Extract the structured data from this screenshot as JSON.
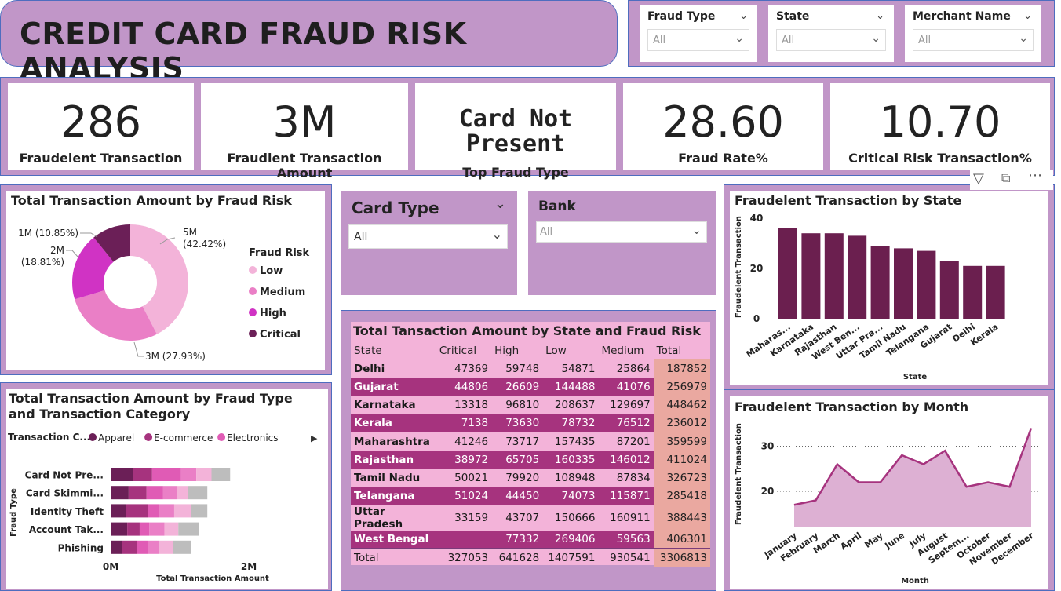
{
  "title": "CREDIT CARD FRAUD RISK ANALYSIS",
  "slicers": [
    {
      "label": "Fraud Type",
      "value": "All"
    },
    {
      "label": "State",
      "value": "All"
    },
    {
      "label": "Merchant Name",
      "value": "All"
    }
  ],
  "kpis": [
    {
      "value": "286",
      "label": "Fraudelent Transaction"
    },
    {
      "value": "3M",
      "label": "Fraudlent Transaction Amount"
    },
    {
      "value": "Card Not Present",
      "label": "Top Fraud Type"
    },
    {
      "value": "28.60",
      "label": "Fraud Rate%"
    },
    {
      "value": "10.70",
      "label": "Critical Risk Transaction%"
    }
  ],
  "card_type": {
    "label": "Card Type",
    "value": "All"
  },
  "bank": {
    "label": "Bank",
    "value": "All"
  },
  "colors": {
    "panel": "#c196c8",
    "low": "#f3b3d9",
    "medium": "#ea7fc6",
    "high": "#d033c4",
    "critical": "#6b1f57",
    "bar": "#6b1f4f",
    "line": "#a6337e",
    "area": "#ddb0d3"
  },
  "chart_data": [
    {
      "type": "pie",
      "title": "Total Transaction Amount by Fraud Risk",
      "legend_title": "Fraud Risk",
      "legend_position": "right",
      "slices": [
        {
          "name": "Low",
          "value": 42.42,
          "label": "5M\n(42.42%)"
        },
        {
          "name": "Medium",
          "value": 27.93,
          "label": "3M (27.93%)"
        },
        {
          "name": "High",
          "value": 18.81,
          "label": "2M\n(18.81%)"
        },
        {
          "name": "Critical",
          "value": 10.85,
          "label": "1M (10.85%)"
        }
      ]
    },
    {
      "type": "bar",
      "orientation": "horizontal",
      "stacked": true,
      "title": "Total Transaction Amount by Fraud Type and Transaction Category",
      "legend_title": "Transaction C...",
      "legend_visible": [
        "Apparel",
        "E-commerce",
        "Electronics"
      ],
      "categories": [
        "Card Not Pre...",
        "Card Skimmi...",
        "Identity Theft",
        "Account Tak...",
        "Phishing"
      ],
      "xlabel": "Total Transaction Amount",
      "ylabel": "Fraud Type",
      "xticks": [
        "0M",
        "2M"
      ],
      "xlim": [
        0,
        3
      ],
      "series": [
        {
          "name": "Apparel",
          "color": "#6b1f57",
          "values": [
            0.32,
            0.26,
            0.22,
            0.24,
            0.16
          ]
        },
        {
          "name": "E-commerce",
          "color": "#a6337e",
          "values": [
            0.28,
            0.26,
            0.32,
            0.18,
            0.22
          ]
        },
        {
          "name": "Electronics",
          "color": "#e05bb5",
          "values": [
            0.42,
            0.24,
            0.16,
            0.14,
            0.16
          ]
        },
        {
          "name": "",
          "color": "#ea7fc6",
          "values": [
            0.22,
            0.2,
            0.22,
            0.22,
            0.16
          ]
        },
        {
          "name": "",
          "color": "#f3b3d9",
          "values": [
            0.22,
            0.16,
            0.24,
            0.2,
            0.2
          ]
        },
        {
          "name": "",
          "color": "#bdbdbd",
          "values": [
            0.27,
            0.28,
            0.24,
            0.3,
            0.26
          ]
        }
      ]
    },
    {
      "type": "table",
      "title": "Total Tansaction Amount by State and Fraud Risk",
      "columns": [
        "State",
        "Critical",
        "High",
        "Low",
        "Medium",
        "Total"
      ],
      "rows": [
        [
          "Delhi",
          "47369",
          "59748",
          "54871",
          "25864",
          "187852"
        ],
        [
          "Gujarat",
          "44806",
          "26609",
          "144488",
          "41076",
          "256979"
        ],
        [
          "Karnataka",
          "13318",
          "96810",
          "208637",
          "129697",
          "448462"
        ],
        [
          "Kerala",
          "7138",
          "73630",
          "78732",
          "76512",
          "236012"
        ],
        [
          "Maharashtra",
          "41246",
          "73717",
          "157435",
          "87201",
          "359599"
        ],
        [
          "Rajasthan",
          "38972",
          "65705",
          "160335",
          "146012",
          "411024"
        ],
        [
          "Tamil Nadu",
          "50021",
          "79920",
          "108948",
          "87834",
          "326723"
        ],
        [
          "Telangana",
          "51024",
          "44450",
          "74073",
          "115871",
          "285418"
        ],
        [
          "Uttar Pradesh",
          "33159",
          "43707",
          "150666",
          "160911",
          "388443"
        ],
        [
          "West Bengal",
          "",
          "77332",
          "269406",
          "59563",
          "406301"
        ]
      ],
      "total": [
        "Total",
        "327053",
        "641628",
        "1407591",
        "930541",
        "3306813"
      ]
    },
    {
      "type": "bar",
      "title": "Fraudelent Transaction by State",
      "xlabel": "State",
      "ylabel": "Fraudelent Transaction",
      "categories": [
        "Maharas...",
        "Karnataka",
        "Rajasthan",
        "West Ben...",
        "Uttar Pra...",
        "Tamil Nadu",
        "Telangana",
        "Gujarat",
        "Delhi",
        "Kerala"
      ],
      "values": [
        36,
        34,
        34,
        33,
        29,
        28,
        27,
        23,
        21,
        21
      ],
      "ylim": [
        0,
        40
      ],
      "yticks": [
        0,
        20,
        40
      ]
    },
    {
      "type": "area",
      "title": "Fraudelent Transaction by Month",
      "xlabel": "Month",
      "ylabel": "Fraudelent Transaction",
      "categories": [
        "January",
        "February",
        "March",
        "April",
        "May",
        "June",
        "July",
        "August",
        "Septem...",
        "October",
        "November",
        "December"
      ],
      "values": [
        17,
        18,
        26,
        22,
        22,
        28,
        26,
        29,
        21,
        22,
        21,
        34
      ],
      "ylim": [
        12,
        36
      ],
      "yticks": [
        20,
        30
      ],
      "grid": true
    }
  ]
}
